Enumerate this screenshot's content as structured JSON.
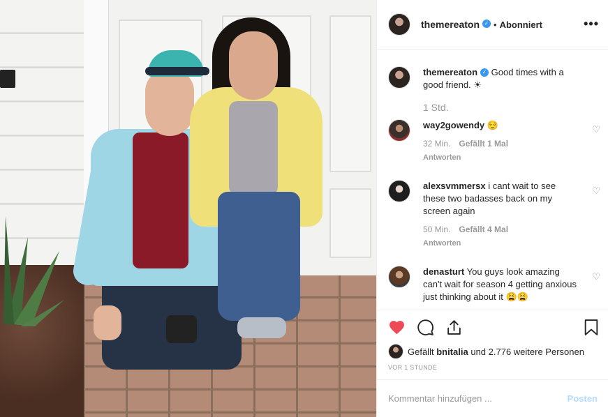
{
  "post": {
    "image_alt": "photo",
    "header": {
      "username": "themereaton",
      "verified": true,
      "separator": "•",
      "follow_status": "Abonniert",
      "more": "•••"
    },
    "caption": {
      "username": "themereaton",
      "text": "Good times with a good friend. ☀",
      "time": "1 Std."
    },
    "comments": [
      {
        "username": "way2gowendy",
        "text": "😌",
        "time": "32 Min.",
        "likes": "Gefällt 1 Mal",
        "reply": "Antworten"
      },
      {
        "username": "alexsvmmersx",
        "text": "i cant wait to see these two badasses back on my screen again",
        "time": "50 Min.",
        "likes": "Gefällt 4 Mal",
        "reply": "Antworten"
      },
      {
        "username": "denasturt",
        "text": "You guys look amazing can't wait for season 4 getting anxious just thinking about it 😩😩",
        "time": "",
        "likes": "",
        "reply": ""
      }
    ],
    "liked_by": {
      "prefix": "Gefällt",
      "user": "bnitalia",
      "suffix": "und 2.776 weitere Personen"
    },
    "timeago": "VOR 1 STUNDE",
    "add_comment": {
      "placeholder": "Kommentar hinzufügen ...",
      "post_label": "Posten"
    },
    "colors": {
      "like_red": "#ed4956",
      "verified_blue": "#3897f0",
      "post_disabled": "#b3dbff"
    }
  }
}
